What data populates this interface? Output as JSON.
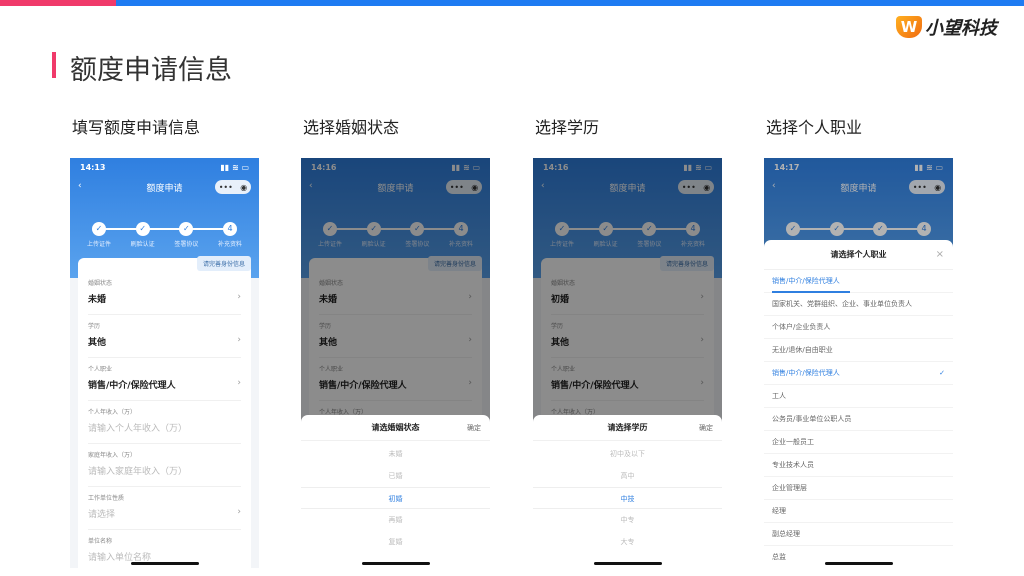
{
  "brand": {
    "name": "小望科技",
    "accent": "#1e7bf2",
    "pink": "#f03a6a"
  },
  "page_title": "额度申请信息",
  "columns": [
    {
      "title": "填写额度申请信息",
      "time": "14:13"
    },
    {
      "title": "选择婚姻状态",
      "time": "14:16"
    },
    {
      "title": "选择学历",
      "time": "14:16"
    },
    {
      "title": "选择个人职业",
      "time": "14:17"
    }
  ],
  "app": {
    "nav_title": "额度申请",
    "back": "‹",
    "capsule_dots": "•••",
    "capsule_close": "◉",
    "signal": "▮▮ ≋ ▭",
    "steps": [
      {
        "label": "上传证件",
        "icon": "✓"
      },
      {
        "label": "刷脸认证",
        "icon": "✓"
      },
      {
        "label": "签署协议",
        "icon": "✓"
      },
      {
        "label": "补充资料",
        "icon": "4"
      }
    ],
    "tag": "请完善身份信息",
    "chevron": "›"
  },
  "forms": [
    [
      {
        "label": "婚姻状态",
        "value": "未婚",
        "chev": true
      },
      {
        "label": "学历",
        "value": "其他",
        "chev": true
      },
      {
        "label": "个人职业",
        "value": "销售/中介/保险代理人",
        "chev": true
      },
      {
        "label": "个人年收入（万）",
        "placeholder": "请输入个人年收入（万）"
      },
      {
        "label": "家庭年收入（万）",
        "placeholder": "请输入家庭年收入（万）"
      },
      {
        "label": "工作单位性质",
        "placeholder": "请选择",
        "chev": true
      },
      {
        "label": "单位名称",
        "placeholder": "请输入单位名称"
      }
    ],
    [
      {
        "label": "婚姻状态",
        "value": "未婚",
        "chev": true
      },
      {
        "label": "学历",
        "value": "其他",
        "chev": true
      },
      {
        "label": "个人职业",
        "value": "销售/中介/保险代理人",
        "chev": true
      },
      {
        "label": "个人年收入（万）",
        "placeholder": ""
      }
    ],
    [
      {
        "label": "婚姻状态",
        "value": "初婚",
        "chev": true
      },
      {
        "label": "学历",
        "value": "其他",
        "chev": true
      },
      {
        "label": "个人职业",
        "value": "销售/中介/保险代理人",
        "chev": true
      },
      {
        "label": "个人年收入（万）",
        "placeholder": ""
      }
    ]
  ],
  "marital_picker": {
    "title": "请选婚姻状态",
    "confirm": "确定",
    "options": [
      "未婚",
      "已婚",
      "初婚",
      "再婚",
      "复婚"
    ],
    "selected": 2
  },
  "education_picker": {
    "title": "请选择学历",
    "confirm": "确定",
    "options": [
      "初中及以下",
      "高中",
      "中技",
      "中专",
      "大专"
    ],
    "selected": 2
  },
  "job_picker": {
    "title": "请选择个人职业",
    "close": "×",
    "current": "销售/中介/保险代理人",
    "check": "✓",
    "selected": 3,
    "options": [
      "国家机关、党群组织、企业、事业单位负责人",
      "个体户/企业负责人",
      "无业/退休/自由职业",
      "销售/中介/保险代理人",
      "工人",
      "公务员/事业单位公职人员",
      "企业一般员工",
      "专业技术人员",
      "企业管理层",
      "经理",
      "副总经理",
      "总监"
    ]
  }
}
